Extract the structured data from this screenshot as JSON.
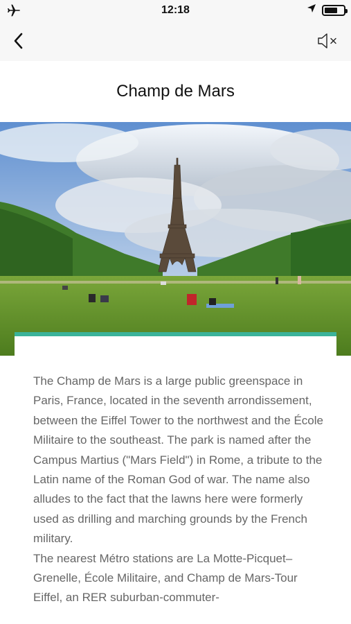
{
  "status_bar": {
    "time": "12:18",
    "airplane_icon": "airplane-icon",
    "location_icon": "location-arrow-icon",
    "battery_icon": "battery-icon",
    "battery_level": 0.7
  },
  "nav": {
    "back_icon": "chevron-left-icon",
    "mute_icon": "speaker-muted-icon"
  },
  "page": {
    "title": "Champ de Mars",
    "image_subject": "Eiffel Tower over Champ de Mars lawn",
    "accent_color": "#3bb39a",
    "paragraphs": [
      "The Champ de Mars is a large public greenspace in Paris, France, located in the seventh arrondissement, between the Eiffel Tower to the northwest and the École Militaire to the southeast. The park is named after the Campus Martius (\"Mars Field\") in Rome, a tribute to the Latin name of the Roman God of war. The name also alludes to the fact that the lawns here were formerly used as drilling and marching grounds by the French military.",
      "The nearest Métro stations are La Motte-Picquet–Grenelle, École Militaire, and Champ de Mars-Tour Eiffel, an RER suburban-commuter-"
    ]
  }
}
